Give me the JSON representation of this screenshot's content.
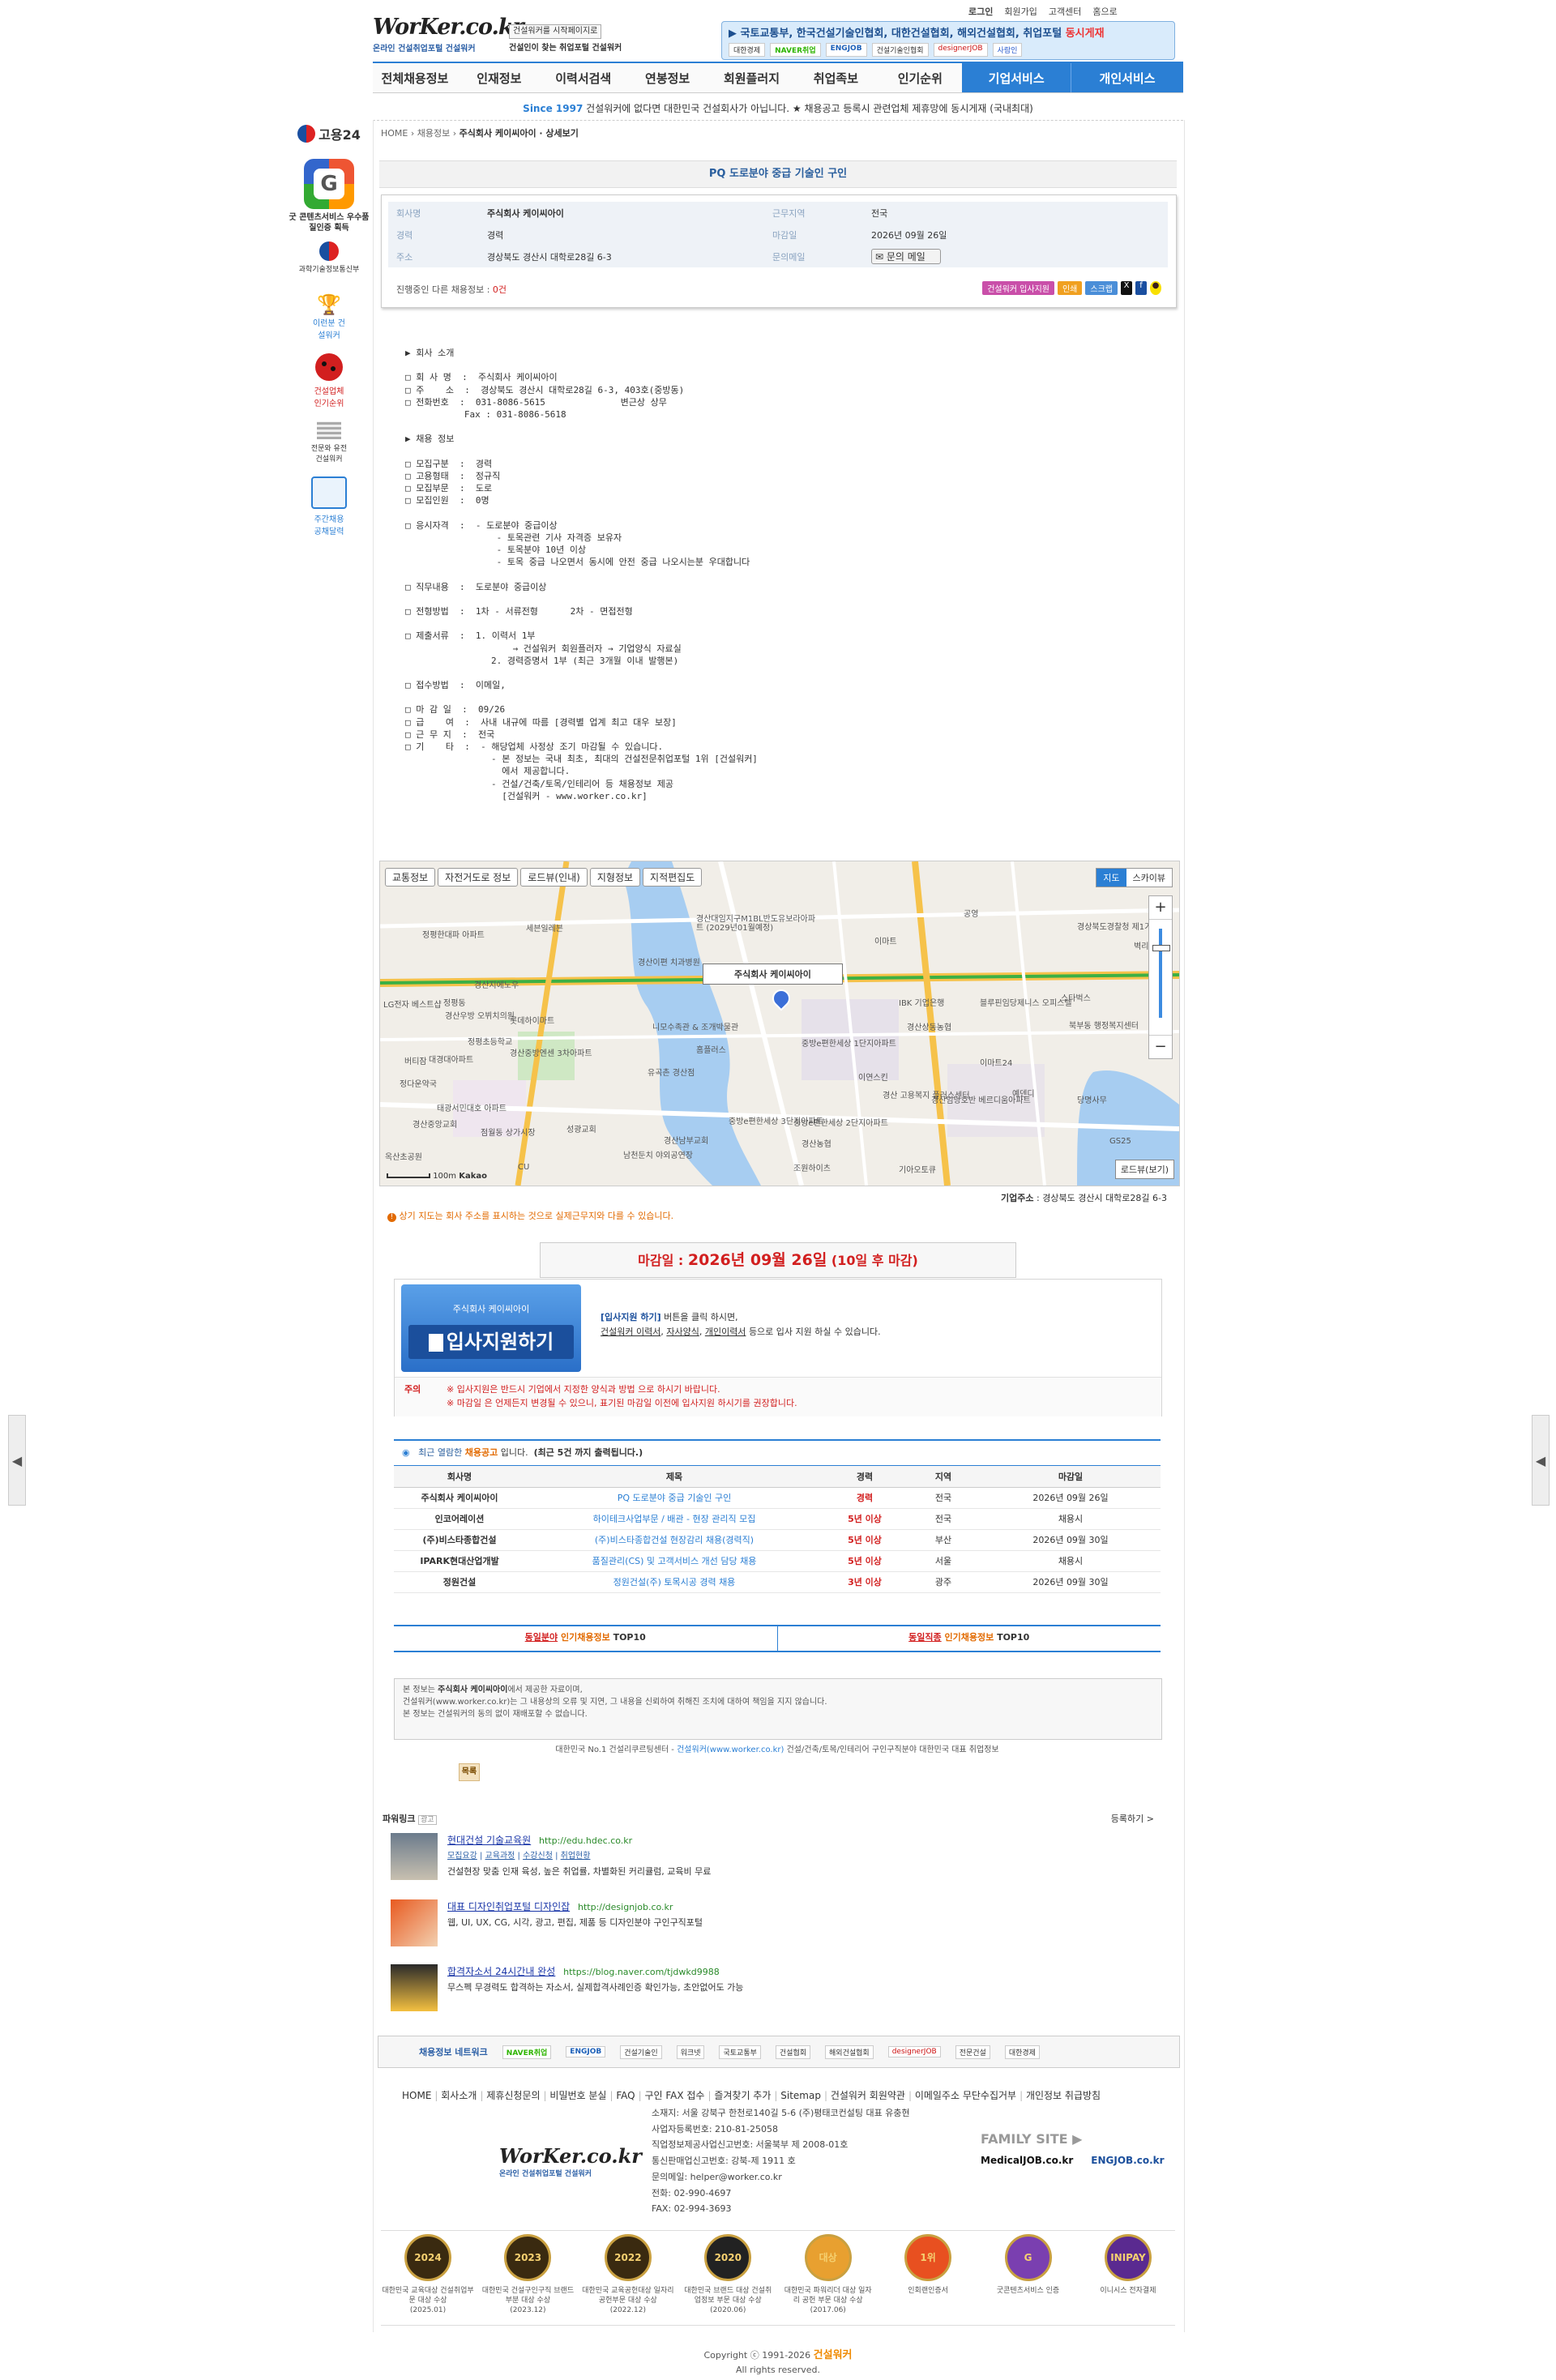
{
  "header": {
    "logo_text": "WorKer.co.kr",
    "logo_tagline": "온라인 건설취업포털 건설워커",
    "promo_box_line1": "건설워커를 시작페이지로",
    "promo_box_line2": "건설인이 찾는 취업포털 건설워커",
    "top_links": [
      "로그인",
      "회원가입",
      "고객센터",
      "홈으로"
    ],
    "banner_text": "▶ 국토교통부, 한국건설기술인협회, 대한건설협회, 해외건설협회, 취업포털",
    "banner_highlight": "동시게재",
    "partner_logos": [
      "대한경제",
      "NAVER취업",
      "ENGJOB",
      "건설기술인협회",
      "designerJOB",
      "사람인"
    ]
  },
  "nav": {
    "items": [
      "전체채용정보",
      "인재정보",
      "이력서검색",
      "연봉정보",
      "회원플러지",
      "취업족보",
      "인기순위"
    ],
    "right_items": [
      "기업서비스",
      "개인서비스"
    ]
  },
  "notice": {
    "since": "Since 1997",
    "text": "건설워커에 없다면 대한민국 건설회사가 아닙니다. ★ 채용공고 등록시 관련업체 제휴망에 동시게재 (국내최대)"
  },
  "sidebar": {
    "items": [
      {
        "label": "고용24",
        "icon": "goyong24-icon"
      },
      {
        "label": "굿 콘텐츠서비스 우수품질인증 획득",
        "icon": "good-content-icon"
      },
      {
        "label": "과학기술정보통신부",
        "icon": "msit-icon"
      },
      {
        "label": "이런분 건설워커",
        "icon": "trophy-icon"
      },
      {
        "label": "건설업체 인기순위",
        "icon": "ladybug-icon"
      },
      {
        "label": "전문와 유전 건설워커",
        "icon": "stack-icon"
      },
      {
        "label": "주간채용 공채달력",
        "icon": "calendar-icon"
      }
    ]
  },
  "breadcrumb": [
    "HOME",
    "채용정보",
    "주식회사 케이씨아이 · 상세보기"
  ],
  "job": {
    "title": "PQ 도로분야 중급 기술인 구인",
    "summary": {
      "company_label": "회사명",
      "company": "주식회사 케이씨아이",
      "region_label": "근무지역",
      "region": "전국",
      "career_label": "경력",
      "career": "경력",
      "deadline_label": "마감일",
      "deadline": "2026년 09월 26일",
      "address_label": "주소",
      "address": "경상북도 경산시 대학로28길 6-3",
      "contact_label": "문의메일",
      "contact_btn": "문의 메일",
      "other_jobs_label": "진행중인 다른 채용정보 :",
      "other_jobs_count": "0건",
      "buttons": [
        "건설워커 입사지원",
        "인쇄",
        "스크랩"
      ]
    },
    "body_lines": [
      "▶ 회사 소개",
      "",
      "□ 회 사 명  :  주식회사 케이씨아이",
      "□ 주    소  :  경상북도 경산시 대학로28길 6-3, 403호(중방동)",
      "□ 전화번호  :  031-8086-5615              변근상 상무",
      "           Fax : 031-8086-5618",
      "",
      "▶ 채용 정보",
      "",
      "□ 모집구분  :  경력",
      "□ 고용형태  :  정규직",
      "□ 모집부문  :  도로",
      "□ 모집인원  :  0명",
      "",
      "□ 응시자격  :  - 도로분야 중급이상",
      "                 - 토목관련 기사 자격증 보유자",
      "                 - 토목분야 10년 이상",
      "                 - 토목 중급 나오면서 동시에 안전 중급 나오시는분 우대합니다",
      "",
      "□ 직무내용  :  도로분야 중급이상",
      "",
      "□ 전형방법  :  1차 - 서류전형      2차 - 면접전형",
      "",
      "□ 제출서류  :  1. 이력서 1부",
      "                    → 건설워커 회원플러자 → 기업양식 자료실",
      "                2. 경력증명서 1부 (최근 3개월 이내 발행본)",
      "",
      "□ 접수방법  :  이메일,",
      "",
      "□ 마 감 일  :  09/26",
      "□ 급    여  :  사내 내규에 따름 [경력별 업계 최고 대우 보장]",
      "□ 근 무 지  :  전국",
      "□ 기    타  :  - 해당업체 사정상 조기 마감될 수 있습니다.",
      "                - 본 정보는 국내 최초, 최대의 건설전문취업포털 1위 [건설워커]",
      "                  에서 제공합니다.",
      "                - 건설/건축/토목/인테리어 등 채용정보 제공",
      "                  [건설워커 - www.worker.co.kr]"
    ]
  },
  "map": {
    "toolbar": [
      "교통정보",
      "자전거도로 정보",
      "로드뷰(인내)",
      "지형정보",
      "지적편집도"
    ],
    "type_buttons": [
      "지도",
      "스카이뷰"
    ],
    "zoom_in": "+",
    "zoom_out": "−",
    "marker_label": "주식회사 케이씨아이",
    "roadview_btn": "로드뷰(보기)",
    "scale": "100m",
    "kakao": "Kakao",
    "labels": [
      "경산대임지구M1BL반도유보라아파트 (2029년01월예정)",
      "경상북도경찰청 제1기동대",
      "정평한대파 아파트",
      "세븐일레븐",
      "경산이편 치과병원",
      "정평동",
      "LG전자 베스트샵",
      "경산지에노우",
      "롯데하이마트",
      "IBK 기업은행",
      "블루핀임당제니스 오피스텔",
      "북부동 행정복지센터",
      "스타벅스",
      "니모수족관 & 조개박물관",
      "홈플러스",
      "중방e편한세상 1단지아파트",
      "경산중방엔센 3차아파트",
      "정평초등학교",
      "대경대아파트",
      "유곡촌 경산점",
      "이연스킨",
      "경산 고용복지 플러스센터",
      "경산임당호반 베르디움아파트",
      "이마트24",
      "예덴디",
      "중방e편한세상 3단지아파트",
      "중방e편한세상 2단지아파트",
      "성광교회",
      "경산남부교회",
      "점월동 상가시장",
      "남천둔치 야외공연장",
      "조원하이츠",
      "경산농협",
      "경산중앙교회",
      "버티잠",
      "정다운약국",
      "태광서민대호 아파트",
      "기아오토큐",
      "옥산초공원",
      "이마트",
      "CU",
      "공영",
      "경산우방 오뷔치의원",
      "GS25",
      "당명사무",
      "벽리",
      "경산상동농협"
    ]
  },
  "company_address_label": "기업주소",
  "company_address": "경상북도 경산시 대학로28길 6-3",
  "map_notice": "상기 지도는 회사 주소를 표시하는 것으로 실제근무지와 다를 수 있습니다.",
  "deadline_box": {
    "prefix": "마감일 :",
    "date": "2026년 09월 26일",
    "suffix": "(10일 후 마감)"
  },
  "apply": {
    "card_company": "주식회사 케이씨아이",
    "card_button": "입사지원하기",
    "desc_link": "[입사지원 하기]",
    "desc_text": "버튼을 클릭 하시면,",
    "desc_line2_links": [
      "건설워커 이력서",
      "자사양식",
      "개인이력서"
    ],
    "desc_line2_text": "등으로 입사 지원 하실 수 있습니다.",
    "caution_label": "주의",
    "caution_1": "※ 입사지원은 반드시 기업에서 지정한 양식과 방법 으로 하시기 바랍니다.",
    "caution_2": "※ 마감일 은 언제든지 변경될 수 있으니, 표기된 마감일 이전에 입사지원 하시기를 권장합니다."
  },
  "recent": {
    "title_prefix": "최근 열람한",
    "title_highlight": "채용공고",
    "title_suffix": "입니다.",
    "title_note": "(최근 5건 까지 출력됩니다.)",
    "headers": [
      "회사명",
      "제목",
      "경력",
      "지역",
      "마감일"
    ],
    "rows": [
      [
        "주식회사 케이씨아이",
        "PQ 도로분야 중급 기술인 구인",
        "경력",
        "전국",
        "2026년 09월 26일"
      ],
      [
        "인코어레이션",
        "하이테크사업부문 / 배관 - 현장 관리직 모집",
        "5년 이상",
        "전국",
        "채용시"
      ],
      [
        "(주)비스타종합건설",
        "(주)비스타종합건설 현장감리 채용(경력직)",
        "5년 이상",
        "부산",
        "2026년 09월 30일"
      ],
      [
        "IPARK현대산업개발",
        "품질관리(CS) 및 고객서비스 개선 담당 채용",
        "5년 이상",
        "서울",
        "채용시"
      ],
      [
        "정원건설",
        "정원건설(주) 토목시공 경력 채용",
        "3년 이상",
        "광주",
        "2026년 09월 30일"
      ]
    ]
  },
  "top10": {
    "left_prefix": "동일분야",
    "left_mid": "인기채용정보",
    "left_suffix": "TOP10",
    "right_prefix": "동일직종",
    "right_mid": "인기채용정보",
    "right_suffix": "TOP10"
  },
  "disclaimer": {
    "line1_prefix": "본 정보는",
    "line1_company": "주식회사 케이씨아이",
    "line1_suffix": "에서 제공한 자료이며,",
    "line2": "건설워커(www.worker.co.kr)는 그 내용상의 오류 및 지연, 그 내용을 신뢰하여 취해진 조치에 대하여 책임을 지지 않습니다.",
    "line3": "본 정보는 건설워커의 동의 없이 재배포할 수 없습니다.",
    "tagline_prefix": "대한민국 No.1 건설리쿠르팅센터 -",
    "tagline_link": "건설워커(www.worker.co.kr)",
    "tagline_suffix": "건설/건축/토목/인테리어 구인구직분야 대한민국 대표 취업정보",
    "list_btn": "목록"
  },
  "powerlink": {
    "title": "파워링크",
    "ad_badge": "광고",
    "register": "등록하기 >",
    "ads": [
      {
        "title": "현대건설 기술교육원",
        "url": "http://edu.hdec.co.kr",
        "sublinks": [
          "모집요강",
          "교육과정",
          "수강신청",
          "취업현황"
        ],
        "desc": "건설현장 맞춤 인재 육성, 높은 취업률, 차별화된 커리큘럼, 교육비 무료"
      },
      {
        "title": "대표 디자인취업포털 디자인잡",
        "url": "http://designjob.co.kr",
        "sublinks": [],
        "desc": "웹, UI, UX, CG, 시각, 광고, 편집, 제품 등 디자인분야 구인구직포털"
      },
      {
        "title": "합격자소서 24시간내 완성",
        "url": "https://blog.naver.com/tjdwkd9988",
        "sublinks": [],
        "desc": "무스펙 무경력도 합격하는 자소서, 실제합격사례인증 확인가능, 초안없어도 가능"
      }
    ]
  },
  "network": {
    "label": "채용정보 네트워크",
    "logos": [
      "NAVER취업",
      "ENGJOB",
      "건설기술인",
      "워크넷",
      "국토교통부",
      "건설협회",
      "해외건설협회",
      "designerJOB",
      "전문건설",
      "대한경제"
    ]
  },
  "footer": {
    "links": [
      "HOME",
      "회사소개",
      "제휴신청문의",
      "비밀번호 분실",
      "FAQ",
      "구인 FAX 접수",
      "즐겨찾기 추가",
      "Sitemap",
      "건설워커 회원약관",
      "이메일주소 무단수집거부",
      "개인정보 취급방침"
    ],
    "info": [
      "소재지: 서울 강북구 한천로140길 5-6 (주)평태코컨설팅 대표 유충현",
      "사업자등록번호: 210-81-25058",
      "직업정보제공사업신고번호: 서울북부 제 2008-01호",
      "통신판매업신고번호: 강북-제 1911 호",
      "문의메일: helper@worker.co.kr",
      "전화: 02-990-4697",
      "FAX: 02-994-3693"
    ],
    "family_site": "FAMILY SITE ▶",
    "family_links": [
      "MedicalJOB.co.kr",
      "ENGJOB.co.kr"
    ],
    "awards": [
      {
        "badge": "2024",
        "text": "대한민국 교육대상 건설취업부문 대상 수상",
        "date": "(2025.01)"
      },
      {
        "badge": "2023",
        "text": "대한민국 건설구인구직 브랜드부분 대상 수상",
        "date": "(2023.12)"
      },
      {
        "badge": "2022",
        "text": "대한민국 교육공헌대상 일자리 공헌부문 대상 수상",
        "date": "(2022.12)"
      },
      {
        "badge": "2020",
        "text": "대한민국 브랜드 대상 건설취업정보 부문 대상 수상",
        "date": "(2020.06)"
      },
      {
        "badge": "대상",
        "text": "대한민국 파워리더 대상 일자리 공헌 부문 대상 수상",
        "date": "(2017.06)"
      },
      {
        "badge": "1위",
        "text": "인회랜인증서",
        "date": ""
      },
      {
        "badge": "G",
        "text": "굿콘텐츠서비스 인증",
        "date": ""
      },
      {
        "badge": "INIPAY",
        "text": "이니시스 전자결제",
        "date": ""
      }
    ],
    "copyright": "Copyright ⓒ 1991-2026",
    "copyright_brand": "건설워커",
    "rights": "All rights reserved."
  },
  "colors": {
    "nav_blue": "#2b7fd4",
    "title_blue": "#2a5f9e",
    "red": "#d21f1f",
    "orange": "#f08a00",
    "table_line": "#2b7fd4"
  }
}
